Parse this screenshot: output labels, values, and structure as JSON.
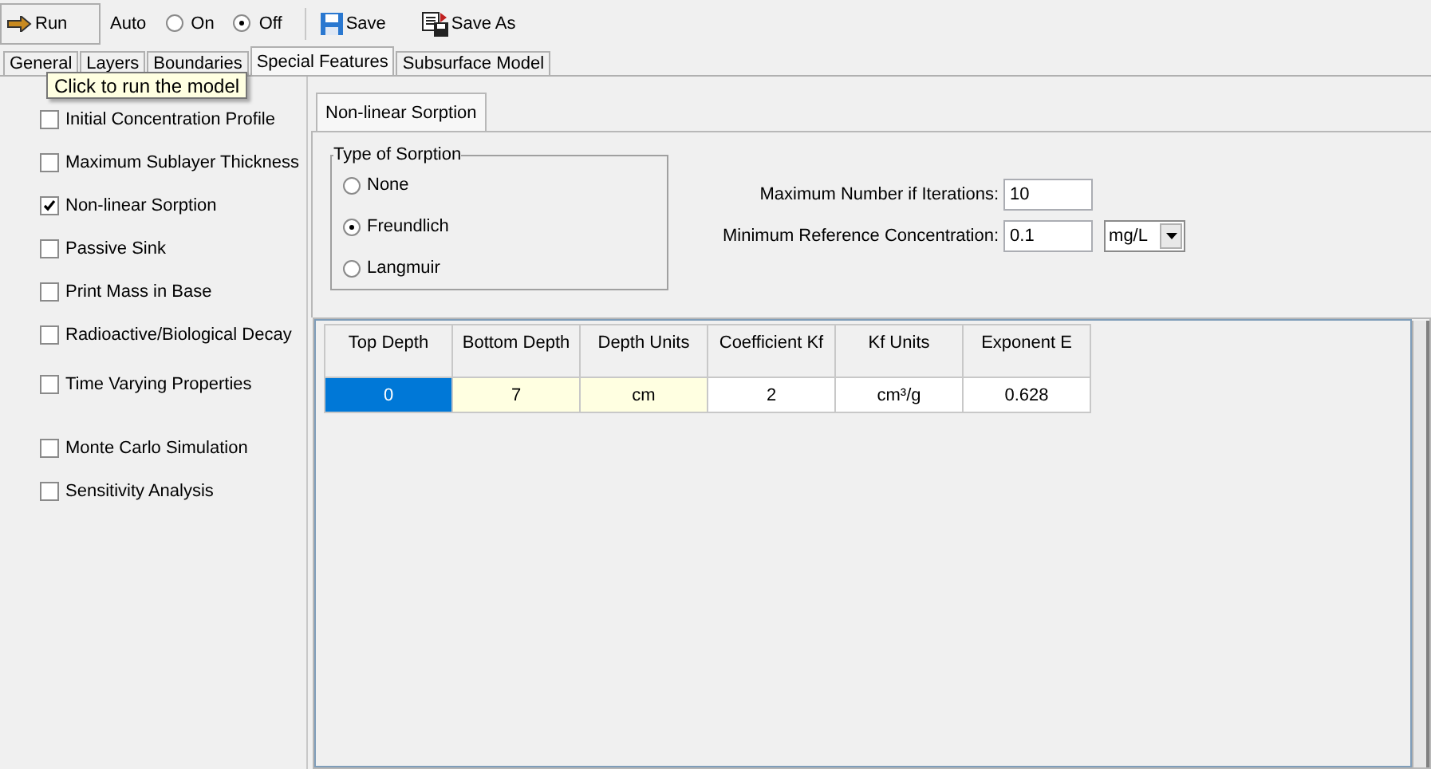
{
  "toolbar": {
    "run": "Run",
    "auto_label": "Auto",
    "auto_options": [
      {
        "label": "On",
        "selected": false
      },
      {
        "label": "Off",
        "selected": true
      }
    ],
    "save": "Save",
    "save_as": "Save As"
  },
  "tooltip": "Click to run the model",
  "tabs": [
    {
      "label": "General",
      "selected": false
    },
    {
      "label": "Layers",
      "selected": false
    },
    {
      "label": "Boundaries",
      "selected": false
    },
    {
      "label": "Special Features",
      "selected": true
    },
    {
      "label": "Subsurface Model",
      "selected": false
    }
  ],
  "features": [
    {
      "label": "Initial Concentration Profile",
      "checked": false
    },
    {
      "label": "Maximum Sublayer Thickness",
      "checked": false
    },
    {
      "label": "Non-linear Sorption",
      "checked": true
    },
    {
      "label": "Passive Sink",
      "checked": false
    },
    {
      "label": "Print Mass in Base",
      "checked": false
    },
    {
      "label": "Radioactive/Biological Decay",
      "checked": false
    },
    {
      "label": "Time Varying Properties",
      "checked": false
    },
    {
      "label": "Monte Carlo Simulation",
      "checked": false
    },
    {
      "label": "Sensitivity Analysis",
      "checked": false
    }
  ],
  "inner_tab": {
    "label": "Non-linear Sorption",
    "selected": true
  },
  "sorption_type": {
    "title": "Type of Sorption",
    "options": [
      {
        "label": "None",
        "selected": false
      },
      {
        "label": "Freundlich",
        "selected": true
      },
      {
        "label": "Langmuir",
        "selected": false
      }
    ]
  },
  "max_iterations": {
    "label": "Maximum Number if Iterations:",
    "value": "10"
  },
  "min_concentration": {
    "label": "Minimum Reference Concentration:",
    "value": "0.1",
    "unit": "mg/L"
  },
  "table": {
    "columns": [
      "Top Depth",
      "Bottom Depth",
      "Depth Units",
      "Coefficient Kf",
      "Kf Units",
      "Exponent E"
    ],
    "rows": [
      [
        {
          "text": "0",
          "selected": true,
          "shaded": false
        },
        {
          "text": "7",
          "selected": false,
          "shaded": true
        },
        {
          "text": "cm",
          "selected": false,
          "shaded": true
        },
        {
          "text": "2",
          "selected": false,
          "shaded": false
        },
        {
          "text": "cm³/g",
          "selected": false,
          "shaded": false
        },
        {
          "text": "0.628",
          "selected": false,
          "shaded": false
        }
      ]
    ]
  }
}
